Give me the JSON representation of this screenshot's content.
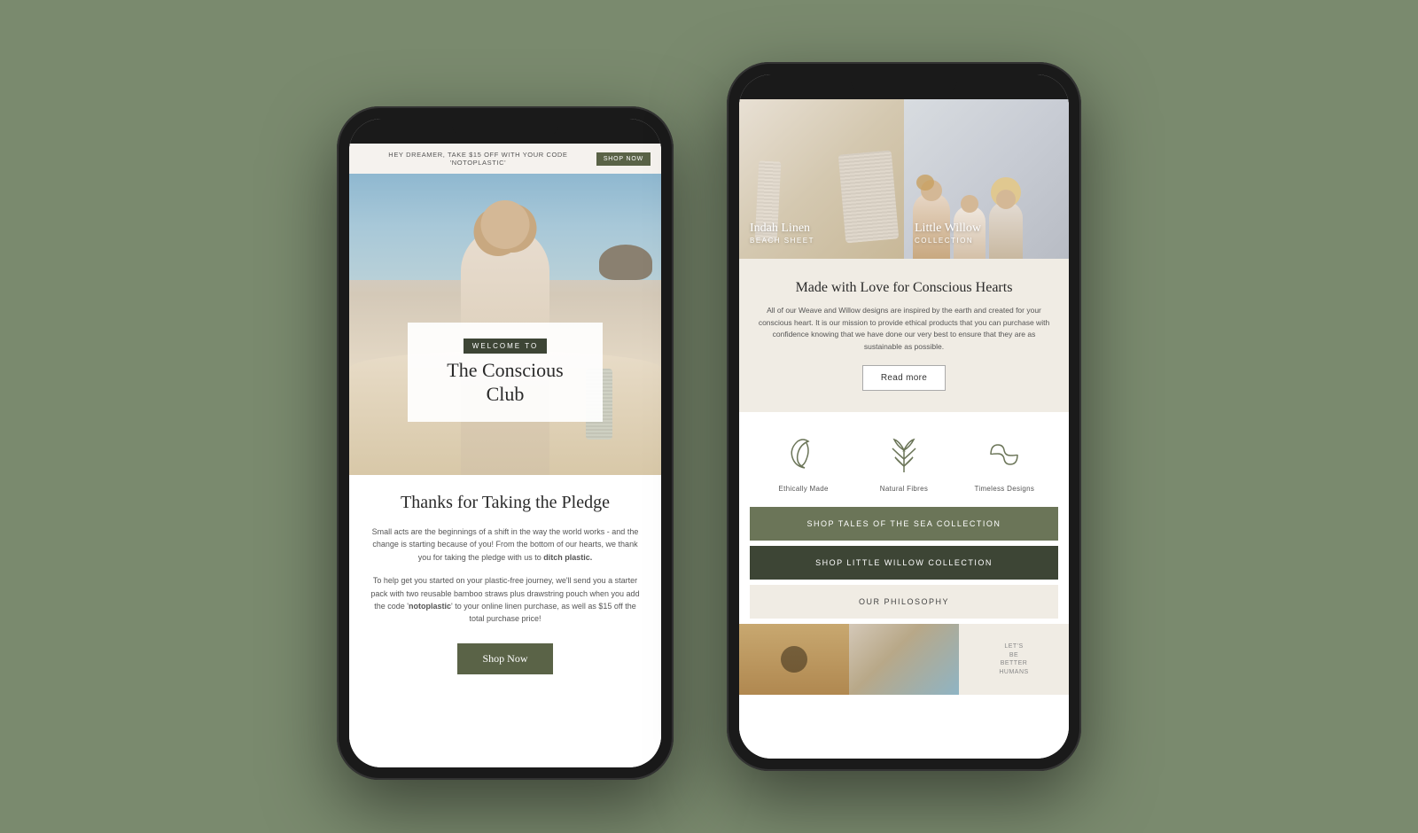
{
  "background": {
    "color": "#7a8a6e"
  },
  "phone1": {
    "banner": {
      "text": "HEY DREAMER, TAKE $15 OFF WITH YOUR CODE  'NOTOPLASTIC'",
      "button": "SHOP NOW"
    },
    "hero": {
      "welcome_label": "WELCOME TO",
      "title": "The Conscious Club"
    },
    "body": {
      "thanks_title": "Thanks for Taking the Pledge",
      "para1": "Small acts are the beginnings of a shift in the way the world works - and the change is starting because of you! From the bottom of our hearts, we thank you for taking the pledge with us to ditch plastic.",
      "para1_bold": "ditch plastic.",
      "para2": "To help get you started on your plastic-free journey, we'll send you a starter pack with two reusable bamboo straws plus drawstring pouch when you add the code 'notoplastic' to your online linen purchase, as well as $15 off the total purchase price!",
      "cta_label": "Shop Now"
    }
  },
  "phone2": {
    "product1": {
      "title": "Indah Linen",
      "subtitle": "BEACH SHEET"
    },
    "product2": {
      "title": "Little Willow",
      "subtitle": "COLLECTION"
    },
    "conscious": {
      "title": "Made with Love for Conscious Hearts",
      "text": "All of our Weave and Willow designs are inspired by the earth and created for your conscious heart. It is our mission to provide ethical products that you can purchase with confidence knowing that we have done our very best to ensure that they are as sustainable as possible.",
      "button": "Read more"
    },
    "icons": [
      {
        "label": "Ethically Made"
      },
      {
        "label": "Natural Fibres"
      },
      {
        "label": "Timeless Designs"
      }
    ],
    "cta_tales": "SHOP TALES OF THE SEA COLLECTION",
    "cta_willow": "SHOP LITTLE WILLOW COLLECTION",
    "cta_philosophy": "OUR PHILOSOPHY",
    "bottom_img3_text": "LET'S\nBE\nBETTER\nHUMANS"
  }
}
